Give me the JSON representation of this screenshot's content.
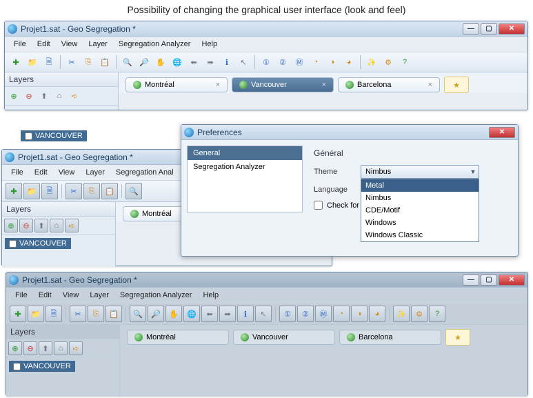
{
  "caption": "Possibility of changing the graphical user interface (look and feel)",
  "window_title": "Projet1.sat - Geo Segregation *",
  "menubar": [
    "File",
    "Edit",
    "View",
    "Layer",
    "Segregation Analyzer",
    "Help"
  ],
  "layers": {
    "title": "Layers",
    "item": "VANCOUVER"
  },
  "tabs": [
    {
      "label": "Montréal",
      "active": false
    },
    {
      "label": "Vancouver",
      "active": true
    },
    {
      "label": "Barcelona",
      "active": false
    }
  ],
  "prefs": {
    "title": "Preferences",
    "categories": [
      "General",
      "Segregation Analyzer"
    ],
    "section_title": "Général",
    "theme_label": "Theme",
    "language_label": "Language",
    "check_label": "Check for new",
    "theme_value": "Nimbus",
    "theme_options": [
      "Metal",
      "Nimbus",
      "CDE/Motif",
      "Windows",
      "Windows Classic"
    ]
  },
  "toolbar_icons": [
    "new",
    "open",
    "copy",
    "cut",
    "copy2",
    "paste",
    "zoom-in",
    "zoom-out",
    "pan",
    "globe",
    "back",
    "forward",
    "info",
    "pointer",
    "one",
    "two",
    "m",
    "c1",
    "c2",
    "c3",
    "wand",
    "gear",
    "help"
  ]
}
